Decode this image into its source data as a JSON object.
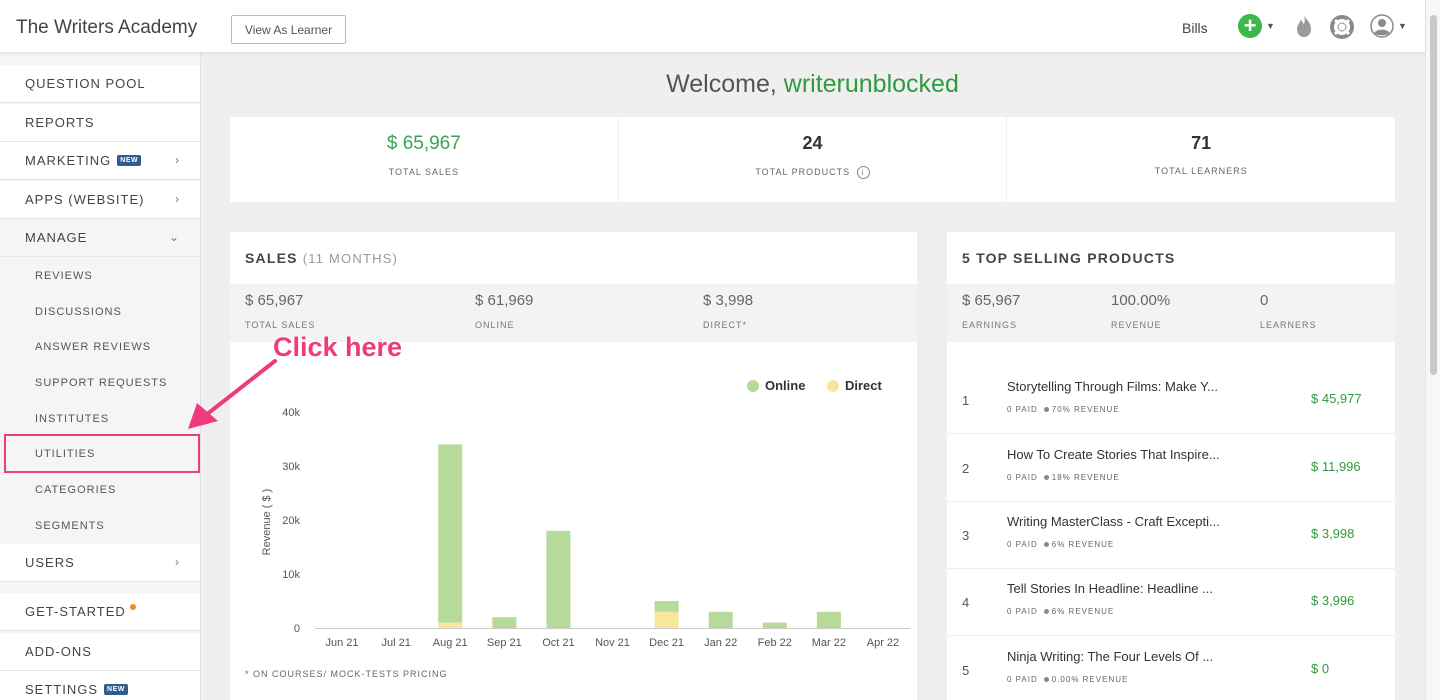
{
  "header": {
    "brand": "The Writers Academy",
    "view_as_learner": "View As Learner",
    "bills": "Bills"
  },
  "sidebar": {
    "items": [
      {
        "label": "QUESTION POOL"
      },
      {
        "label": "REPORTS"
      },
      {
        "label": "MARKETING",
        "badge": "NEW"
      },
      {
        "label": "APPS (WEBSITE)"
      },
      {
        "label": "MANAGE"
      }
    ],
    "manage_sub": [
      {
        "label": "REVIEWS"
      },
      {
        "label": "DISCUSSIONS"
      },
      {
        "label": "ANSWER REVIEWS"
      },
      {
        "label": "SUPPORT REQUESTS"
      },
      {
        "label": "INSTITUTES"
      },
      {
        "label": "UTILITIES"
      },
      {
        "label": "CATEGORIES"
      },
      {
        "label": "SEGMENTS"
      }
    ],
    "bottom_items": [
      {
        "label": "USERS"
      },
      {
        "label": "GET-STARTED"
      },
      {
        "label": "ADD-ONS"
      },
      {
        "label": "SETTINGS",
        "badge": "NEW"
      }
    ]
  },
  "annotation": {
    "text": "Click here",
    "color": "#ef3a7e"
  },
  "welcome": {
    "prefix": "Welcome,",
    "username": "writerunblocked"
  },
  "stats": [
    {
      "value": "$ 65,967",
      "label": "TOTAL SALES"
    },
    {
      "value": "24",
      "label": "TOTAL PRODUCTS"
    },
    {
      "value": "71",
      "label": "TOTAL LEARNERS"
    }
  ],
  "sales": {
    "title": "SALES",
    "period": "(11 MONTHS)",
    "summary": [
      {
        "value": "$ 65,967",
        "label": "TOTAL SALES"
      },
      {
        "value": "$ 61,969",
        "label": "ONLINE"
      },
      {
        "value": "$ 3,998",
        "label": "DIRECT*"
      }
    ],
    "footnote": "* ON COURSES/ MOCK-TESTS PRICING"
  },
  "chart_data": {
    "type": "bar",
    "stacked": true,
    "categories": [
      "Jun 21",
      "Jul 21",
      "Aug 21",
      "Sep 21",
      "Oct 21",
      "Nov 21",
      "Dec 21",
      "Jan 22",
      "Feb 22",
      "Mar 22",
      "Apr 22"
    ],
    "series": [
      {
        "name": "Online",
        "color": "#b5da9a",
        "values": [
          0,
          0,
          33000,
          2000,
          18000,
          0,
          2000,
          3000,
          1000,
          3000,
          0
        ]
      },
      {
        "name": "Direct",
        "color": "#f8e69c",
        "values": [
          0,
          0,
          1000,
          0,
          0,
          0,
          3000,
          0,
          0,
          0,
          0
        ]
      }
    ],
    "ylabel": "Revenue ( $ )",
    "yticks": [
      "0",
      "10k",
      "20k",
      "30k",
      "40k"
    ],
    "ylim": [
      0,
      40000
    ],
    "legend": "top-right"
  },
  "top_products": {
    "title": "5 TOP SELLING PRODUCTS",
    "summary": [
      {
        "value": "$ 65,967",
        "label": "EARNINGS"
      },
      {
        "value": "100.00%",
        "label": "REVENUE"
      },
      {
        "value": "0",
        "label": "LEARNERS"
      }
    ],
    "rows": [
      {
        "rank": "1",
        "name": "Storytelling Through Films: Make Y...",
        "paid": "0 PAID",
        "share": "70% REVENUE",
        "revenue": "$ 45,977"
      },
      {
        "rank": "2",
        "name": "How To Create Stories That Inspire...",
        "paid": "0 PAID",
        "share": "18% REVENUE",
        "revenue": "$ 11,996"
      },
      {
        "rank": "3",
        "name": "Writing MasterClass - Craft Excepti...",
        "paid": "0 PAID",
        "share": "6% REVENUE",
        "revenue": "$ 3,998"
      },
      {
        "rank": "4",
        "name": "Tell Stories In Headline: Headline ...",
        "paid": "0 PAID",
        "share": "6% REVENUE",
        "revenue": "$ 3,996"
      },
      {
        "rank": "5",
        "name": "Ninja Writing: The Four Levels Of ...",
        "paid": "0 PAID",
        "share": "0.00% REVENUE",
        "revenue": "$ 0"
      }
    ]
  },
  "colors": {
    "accent_green": "#3aa356",
    "annotation_pink": "#ec3e77"
  }
}
